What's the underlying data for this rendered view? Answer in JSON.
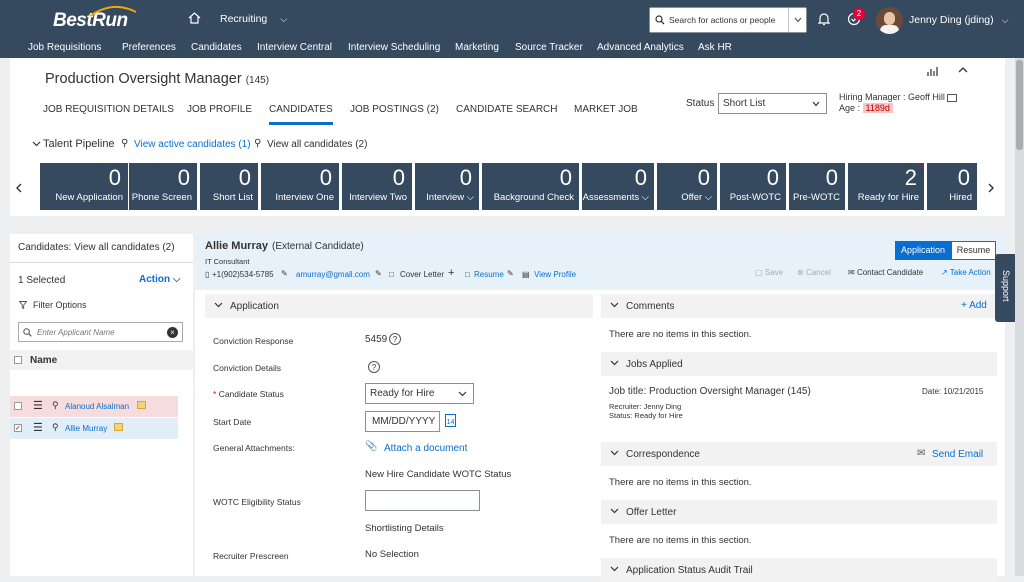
{
  "shell": {
    "brand": "BestRun",
    "module": "Recruiting",
    "search_placeholder": "Search for actions or people",
    "notification_count": "2",
    "user": "Jenny Ding (jding)",
    "nav": [
      "Job Requisitions",
      "Preferences",
      "Candidates",
      "Interview Central",
      "Interview Scheduling",
      "Marketing",
      "Source Tracker",
      "Advanced Analytics",
      "Ask HR"
    ]
  },
  "job": {
    "title": "Production Oversight Manager",
    "id": "(145)",
    "tabs": [
      "JOB REQUISITION DETAILS",
      "JOB PROFILE",
      "CANDIDATES",
      "JOB POSTINGS (2)",
      "CANDIDATE SEARCH",
      "MARKET JOB"
    ],
    "active_tab": "CANDIDATES",
    "status_label": "Status",
    "status_value": "Short List",
    "hiring_manager_label": "Hiring Manager :",
    "hiring_manager": "Geoff Hill",
    "age_label": "Age :",
    "age": "1189d"
  },
  "pipeline": {
    "title": "Talent Pipeline",
    "active_link": "View active candidates (1)",
    "all_link": "View all candidates (2)",
    "stages": [
      {
        "count": "0",
        "label": "New Application"
      },
      {
        "count": "0",
        "label": "Phone Screen"
      },
      {
        "count": "0",
        "label": "Short List"
      },
      {
        "count": "0",
        "label": "Interview One"
      },
      {
        "count": "0",
        "label": "Interview Two"
      },
      {
        "count": "0",
        "label": "Interview"
      },
      {
        "count": "0",
        "label": "Background Check"
      },
      {
        "count": "0",
        "label": "Assessments"
      },
      {
        "count": "0",
        "label": "Offer"
      },
      {
        "count": "0",
        "label": "Post-WOTC"
      },
      {
        "count": "0",
        "label": "Pre-WOTC"
      },
      {
        "count": "2",
        "label": "Ready for Hire"
      },
      {
        "count": "0",
        "label": "Hired"
      }
    ]
  },
  "left": {
    "header": "Candidates: View all candidates (2)",
    "selected": "1 Selected",
    "action": "Action",
    "filter": "Filter Options",
    "filter_placeholder": "Enter Applicant Name",
    "col_name": "Name",
    "rows": [
      {
        "name": "Alanoud Alsalman",
        "checked": false,
        "bg": "#f6dcdc"
      },
      {
        "name": "Allie Murray",
        "checked": true,
        "bg": "#e1eef8"
      }
    ]
  },
  "candidate": {
    "name": "Allie Murray",
    "type": "(External Candidate)",
    "role": "IT Consultant",
    "phone": "+1(902)534-5785",
    "email": "amurray@gmail.com",
    "cover_letter": "Cover Letter",
    "resume": "Resume",
    "view_profile": "View Profile",
    "btn_application": "Application",
    "btn_resume": "Resume",
    "save": "Save",
    "cancel": "Cancel",
    "contact": "Contact Candidate",
    "take_action": "Take Action"
  },
  "application": {
    "header": "Application",
    "conviction_response_label": "Conviction Response",
    "conviction_response": "5459",
    "conviction_details_label": "Conviction Details",
    "candidate_status_label": "Candidate Status",
    "candidate_status": "Ready for Hire",
    "start_date_label": "Start Date",
    "start_date_placeholder": "MM/DD/YYYY",
    "attachments_label": "General Attachments:",
    "attach_link": "Attach a document",
    "wotc_status_heading": "New Hire Candidate WOTC Status",
    "wotc_label": "WOTC Eligibility Status",
    "shortlisting": "Shortlisting Details",
    "prescreen_label": "Recruiter Prescreen",
    "prescreen_value": "No Selection"
  },
  "right": {
    "comments": "Comments",
    "add": "+ Add",
    "no_items": "There are no items in this section.",
    "jobs_applied": "Jobs Applied",
    "job_title": "Job title: Production Oversight Manager (145)",
    "job_date": "Date: 10/21/2015",
    "job_recruiter": "Recruiter: Jenny Ding",
    "job_status": "Status: Ready for Hire",
    "correspondence": "Correspondence",
    "send_email": "Send Email",
    "offer_letter": "Offer Letter",
    "audit": "Application Status Audit Trail"
  },
  "support": "Support",
  "colors": {
    "shell": "#354a5f",
    "accent": "#0a6ed1",
    "badge": "#e9003a"
  }
}
